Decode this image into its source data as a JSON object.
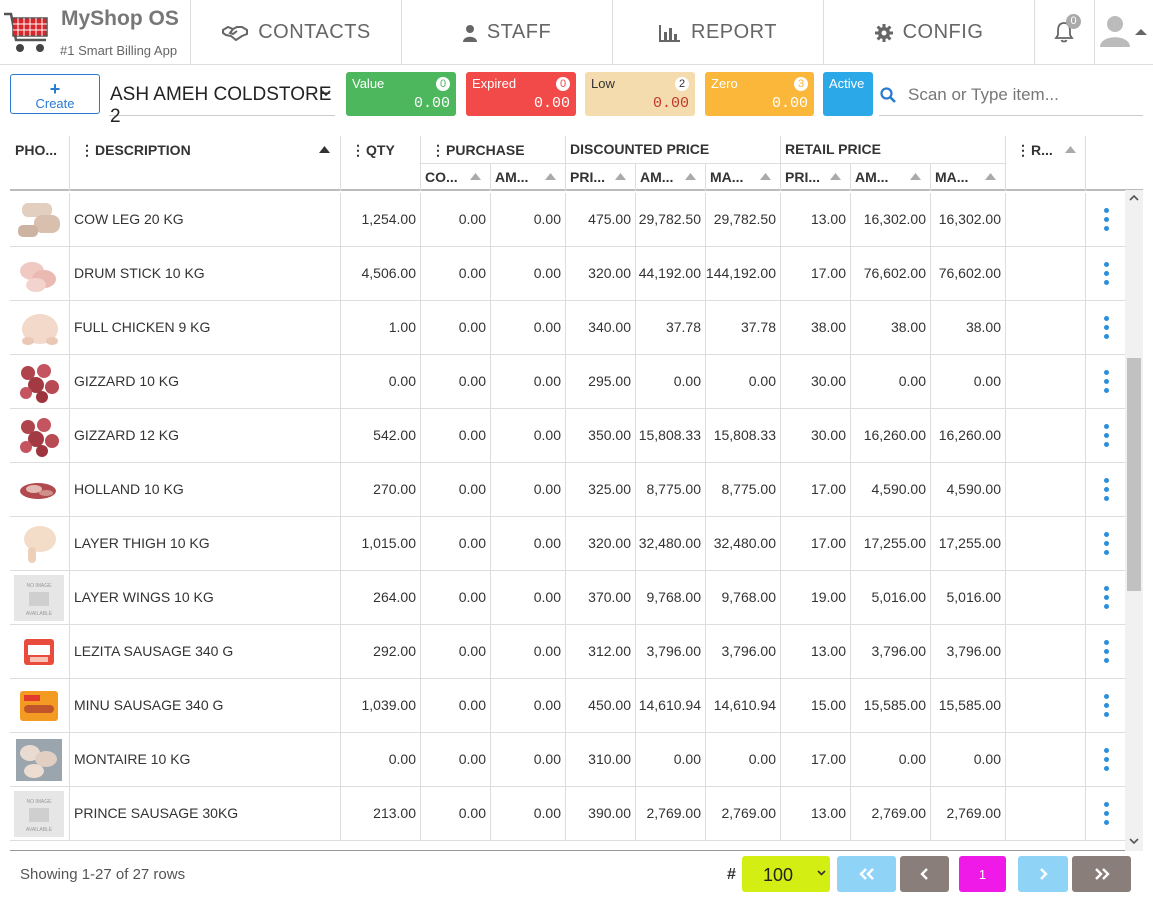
{
  "brand": {
    "name": "MyShop OS",
    "tagline": "#1 Smart Billing App"
  },
  "nav": [
    {
      "label": "CONTACTS",
      "icon": "handshake-icon"
    },
    {
      "label": "STAFF",
      "icon": "user-icon"
    },
    {
      "label": "REPORT",
      "icon": "bar-chart-icon"
    },
    {
      "label": "CONFIG",
      "icon": "gear-icon"
    }
  ],
  "notifications": {
    "count": "0"
  },
  "toolbar": {
    "create_label": "Create",
    "store": "ASH AMEH COLDSTORE 2",
    "cards": {
      "value": {
        "label": "Value",
        "count": "0",
        "amount": "0.00",
        "color": "#4cb75c"
      },
      "expired": {
        "label": "Expired",
        "count": "0",
        "amount": "0.00",
        "color": "#f24a48"
      },
      "low": {
        "label": "Low",
        "count": "2",
        "amount": "0.00",
        "color": "#f5dcae"
      },
      "zero": {
        "label": "Zero",
        "count": "3",
        "amount": "0.00",
        "color": "#fbb73a"
      },
      "active": {
        "label": "Active",
        "color": "#2aa8e8"
      }
    },
    "search_placeholder": "Scan or Type item..."
  },
  "table": {
    "headers": {
      "photo": "PHO...",
      "description": "DESCRIPTION",
      "qty": "QTY",
      "purchase": "PURCHASE",
      "purchase_cost": "CO...",
      "purchase_amount": "AM...",
      "discounted": "DISCOUNTED PRICE",
      "disc_price": "PRI...",
      "disc_amount": "AM...",
      "disc_margin": "MA...",
      "retail": "RETAIL PRICE",
      "ret_price": "PRI...",
      "ret_amount": "AM...",
      "ret_margin": "MA...",
      "r": "R..."
    },
    "rows": [
      {
        "desc": "COW LEG 20 KG",
        "qty": "1,254.00",
        "pc": "0.00",
        "pa": "0.00",
        "dp": "475.00",
        "da": "29,782.50",
        "dm": "29,782.50",
        "rp": "13.00",
        "ra": "16,302.00",
        "rm": "16,302.00",
        "img": "cowleg"
      },
      {
        "desc": "DRUM STICK 10 KG",
        "qty": "4,506.00",
        "pc": "0.00",
        "pa": "0.00",
        "dp": "320.00",
        "da": "44,192.00",
        "dm": "144,192.00",
        "rp": "17.00",
        "ra": "76,602.00",
        "rm": "76,602.00",
        "img": "drum"
      },
      {
        "desc": "FULL CHICKEN 9 KG",
        "qty": "1.00",
        "pc": "0.00",
        "pa": "0.00",
        "dp": "340.00",
        "da": "37.78",
        "dm": "37.78",
        "rp": "38.00",
        "ra": "38.00",
        "rm": "38.00",
        "img": "chicken"
      },
      {
        "desc": "GIZZARD 10 KG",
        "qty": "0.00",
        "pc": "0.00",
        "pa": "0.00",
        "dp": "295.00",
        "da": "0.00",
        "dm": "0.00",
        "rp": "30.00",
        "ra": "0.00",
        "rm": "0.00",
        "img": "gizzard"
      },
      {
        "desc": "GIZZARD 12 KG",
        "qty": "542.00",
        "pc": "0.00",
        "pa": "0.00",
        "dp": "350.00",
        "da": "15,808.33",
        "dm": "15,808.33",
        "rp": "30.00",
        "ra": "16,260.00",
        "rm": "16,260.00",
        "img": "gizzard"
      },
      {
        "desc": "HOLLAND 10 KG",
        "qty": "270.00",
        "pc": "0.00",
        "pa": "0.00",
        "dp": "325.00",
        "da": "8,775.00",
        "dm": "8,775.00",
        "rp": "17.00",
        "ra": "4,590.00",
        "rm": "4,590.00",
        "img": "holland"
      },
      {
        "desc": "LAYER THIGH 10 KG",
        "qty": "1,015.00",
        "pc": "0.00",
        "pa": "0.00",
        "dp": "320.00",
        "da": "32,480.00",
        "dm": "32,480.00",
        "rp": "17.00",
        "ra": "17,255.00",
        "rm": "17,255.00",
        "img": "thigh"
      },
      {
        "desc": "LAYER WINGS 10 KG",
        "qty": "264.00",
        "pc": "0.00",
        "pa": "0.00",
        "dp": "370.00",
        "da": "9,768.00",
        "dm": "9,768.00",
        "rp": "19.00",
        "ra": "5,016.00",
        "rm": "5,016.00",
        "img": "noimage"
      },
      {
        "desc": "LEZITA SAUSAGE 340 G",
        "qty": "292.00",
        "pc": "0.00",
        "pa": "0.00",
        "dp": "312.00",
        "da": "3,796.00",
        "dm": "3,796.00",
        "rp": "13.00",
        "ra": "3,796.00",
        "rm": "3,796.00",
        "img": "lezita"
      },
      {
        "desc": "MINU SAUSAGE 340 G",
        "qty": "1,039.00",
        "pc": "0.00",
        "pa": "0.00",
        "dp": "450.00",
        "da": "14,610.94",
        "dm": "14,610.94",
        "rp": "15.00",
        "ra": "15,585.00",
        "rm": "15,585.00",
        "img": "minu"
      },
      {
        "desc": "MONTAIRE 10 KG",
        "qty": "0.00",
        "pc": "0.00",
        "pa": "0.00",
        "dp": "310.00",
        "da": "0.00",
        "dm": "0.00",
        "rp": "17.00",
        "ra": "0.00",
        "rm": "0.00",
        "img": "montaire"
      },
      {
        "desc": "PRINCE SAUSAGE 30KG",
        "qty": "213.00",
        "pc": "0.00",
        "pa": "0.00",
        "dp": "390.00",
        "da": "2,769.00",
        "dm": "2,769.00",
        "rp": "13.00",
        "ra": "2,769.00",
        "rm": "2,769.00",
        "img": "noimage"
      }
    ],
    "no_image_text": [
      "NO IMAGE",
      "AVAILABLE"
    ]
  },
  "footer": {
    "showing": "Showing 1-27 of 27 rows",
    "hash": "#",
    "per_page": "100",
    "current_page": "1",
    "colors": {
      "first": "#8fd3f7",
      "prev": "#8a7e7a",
      "page": "#f01ae8",
      "next": "#8fd3f7",
      "last": "#8a7e7a"
    }
  }
}
